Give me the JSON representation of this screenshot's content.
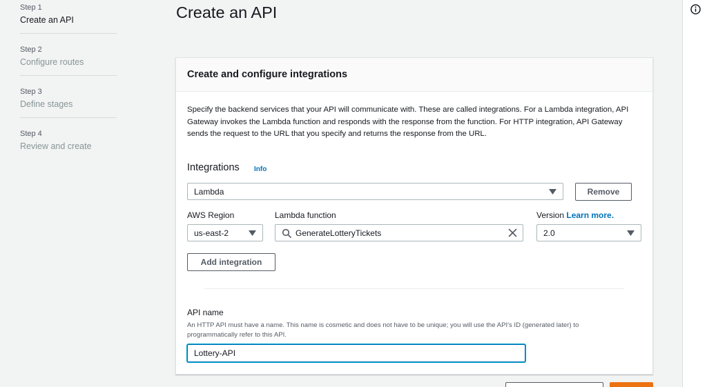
{
  "steps": [
    {
      "number": "Step 1",
      "name": "Create an API",
      "active": true
    },
    {
      "number": "Step 2",
      "name": "Configure routes",
      "active": false
    },
    {
      "number": "Step 3",
      "name": "Define stages",
      "active": false
    },
    {
      "number": "Step 4",
      "name": "Review and create",
      "active": false
    }
  ],
  "page": {
    "title": "Create an API"
  },
  "card": {
    "title": "Create and configure integrations",
    "description": "Specify the backend services that your API will communicate with. These are called integrations. For a Lambda integration, API Gateway invokes the Lambda function and responds with the response from the function. For HTTP integration, API Gateway sends the request to the URL that you specify and returns the response from the URL.",
    "integrations_label": "Integrations",
    "info_link": "Info",
    "integration_type": "Lambda",
    "remove_button": "Remove",
    "region_label": "AWS Region",
    "region_value": "us-east-2",
    "function_label": "Lambda function",
    "function_value": "GenerateLotteryTickets",
    "version_label": "Version",
    "version_learn_more": "Learn more.",
    "version_value": "2.0",
    "add_integration_button": "Add integration",
    "api_name_label": "API name",
    "api_name_hint": "An HTTP API must have a name. This name is cosmetic and does not have to be unique; you will use the API's ID (generated later) to programmatically refer to this API.",
    "api_name_value": "Lottery-API"
  },
  "colors": {
    "link": "#0073bb",
    "primary_button": "#ec7211",
    "input_focus": "#0073bb",
    "background": "#f2f3f3"
  },
  "icons": {
    "help": "info-circle-icon",
    "dropdown": "caret-down-icon",
    "search": "search-icon",
    "clear": "close-icon"
  }
}
